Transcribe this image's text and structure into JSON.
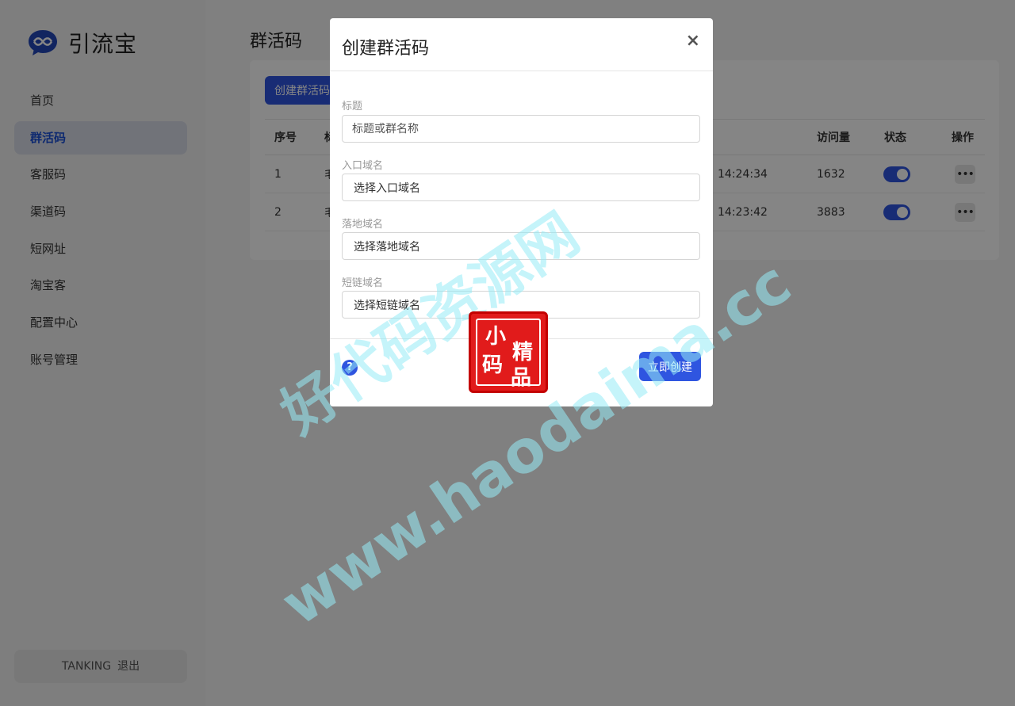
{
  "app": {
    "name": "引流宝",
    "logo_icon": "chat-link-icon",
    "brand_color": "#2f55e0"
  },
  "sidebar": {
    "items": [
      {
        "label": "首页",
        "active": false
      },
      {
        "label": "群活码",
        "active": true
      },
      {
        "label": "客服码",
        "active": false
      },
      {
        "label": "渠道码",
        "active": false
      },
      {
        "label": "短网址",
        "active": false
      },
      {
        "label": "淘宝客",
        "active": false
      },
      {
        "label": "配置中心",
        "active": false
      },
      {
        "label": "账号管理",
        "active": false
      }
    ],
    "user": {
      "name": "TANKING",
      "logout": "退出"
    }
  },
  "main": {
    "title": "群活码",
    "create_button": "创建群活码",
    "table": {
      "headers": {
        "index": "序号",
        "col2": "标",
        "visits": "访问量",
        "status": "状态",
        "actions": "操作"
      },
      "rows": [
        {
          "index": "1",
          "col2": "毛",
          "time": "14:24:34",
          "visits": "1632",
          "enabled": true
        },
        {
          "index": "2",
          "col2": "毛",
          "time": "14:23:42",
          "visits": "3883",
          "enabled": true
        }
      ]
    }
  },
  "modal": {
    "title": "创建群活码",
    "close": "×",
    "fields": {
      "title": {
        "label": "标题",
        "placeholder": "标题或群名称"
      },
      "entry_domain": {
        "label": "入口域名",
        "value": "选择入口域名"
      },
      "landing_domain": {
        "label": "落地域名",
        "value": "选择落地域名"
      },
      "short_domain": {
        "label": "短链域名",
        "value": "选择短链域名"
      }
    },
    "help_icon": "?",
    "submit": "立即创建"
  },
  "watermark": {
    "line1": "好代码资源网",
    "line2": "www.haodaima.cc",
    "stamp": [
      "小",
      "精",
      "码",
      "品"
    ]
  }
}
